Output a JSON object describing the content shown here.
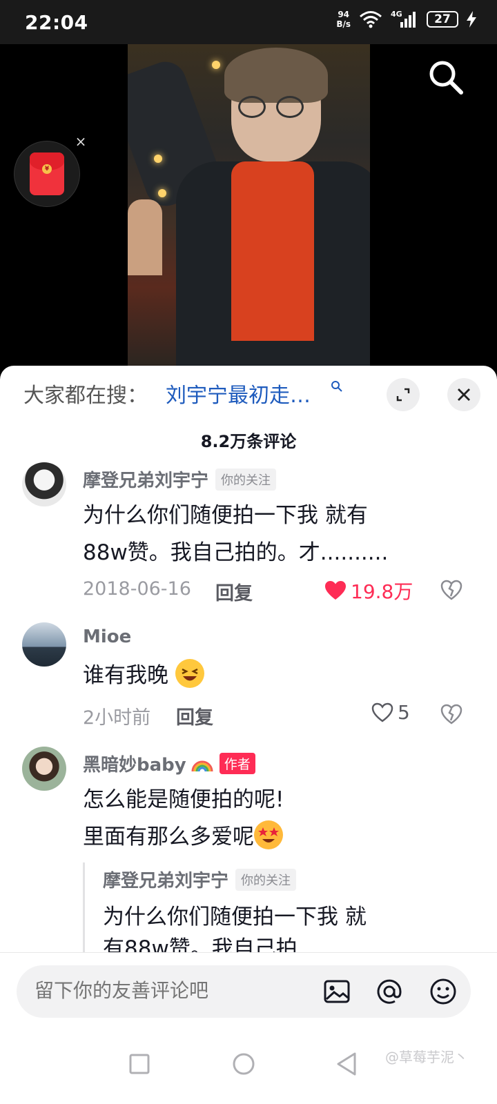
{
  "status_bar": {
    "time": "22:04",
    "net_speed_top": "94",
    "net_speed_bottom": "B/s",
    "network": "4G",
    "battery": "27"
  },
  "sheet": {
    "search_prefix": "大家都在搜：",
    "search_term": "刘宇宁最初走…",
    "comment_count": "8.2万条评论"
  },
  "comments": [
    {
      "author": "摩登兄弟刘宇宁",
      "tag": "你的关注",
      "text_line1": "为什么你们随便拍一下我 就有",
      "text_line2": "88w赞。我自己拍的。才..........",
      "time": "2018-06-16",
      "reply": "回复",
      "likes": "19.8万",
      "liked": true
    },
    {
      "author": "Mioe",
      "text": "谁有我晚",
      "time": "2小时前",
      "reply": "回复",
      "likes": "5",
      "liked": false
    },
    {
      "author": "黑暗妙baby",
      "tag": "作者",
      "text_line1": "怎么能是随便拍的呢!",
      "text_line2": "里面有那么多爱呢",
      "quote": {
        "author": "摩登兄弟刘宇宁",
        "tag": "你的关注",
        "text": "为什么你们随便拍一下我 就有88w赞。我自己拍"
      }
    }
  ],
  "input": {
    "placeholder": "留下你的友善评论吧"
  },
  "watermark": "@草莓芋泥丶",
  "colors": {
    "accent": "#fe2c55",
    "link": "#1e5bbd",
    "text": "#161823",
    "muted": "#9a9ba1"
  }
}
